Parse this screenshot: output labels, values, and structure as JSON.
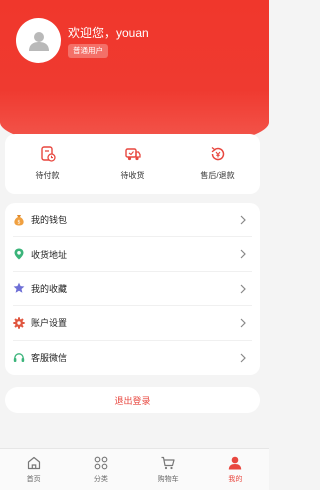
{
  "header": {
    "welcome": "欢迎您，youan",
    "badge": "普通用户"
  },
  "orders": [
    {
      "label": "待付款",
      "icon": "wallet-clock-icon"
    },
    {
      "label": "待收货",
      "icon": "truck-icon"
    },
    {
      "label": "售后/退款",
      "icon": "refund-icon"
    }
  ],
  "menu": [
    {
      "label": "我的钱包",
      "icon": "money-bag-icon"
    },
    {
      "label": "收货地址",
      "icon": "location-pin-icon"
    },
    {
      "label": "我的收藏",
      "icon": "star-icon"
    },
    {
      "label": "账户设置",
      "icon": "gear-icon"
    },
    {
      "label": "客服微信",
      "icon": "headset-icon"
    }
  ],
  "logout": "退出登录",
  "tabs": [
    {
      "label": "首页",
      "icon": "home-icon"
    },
    {
      "label": "分类",
      "icon": "grid-icon"
    },
    {
      "label": "购物车",
      "icon": "cart-icon"
    },
    {
      "label": "我的",
      "icon": "user-icon",
      "active": true
    }
  ],
  "colors": {
    "brand": "#ef3a30",
    "accent_text": "#e8473f"
  }
}
